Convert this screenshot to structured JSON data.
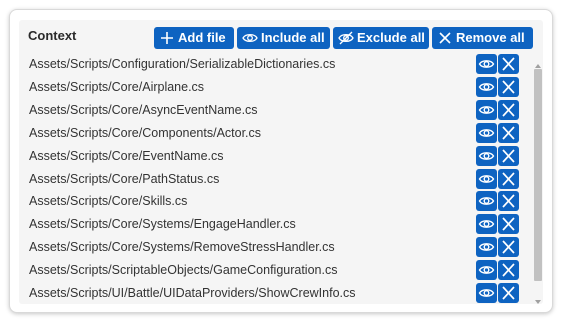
{
  "context_panel": {
    "title": "Context",
    "buttons": {
      "add_file": "Add file",
      "include_all": "Include all",
      "exclude_all": "Exclude all",
      "remove_all": "Remove all"
    },
    "files": [
      "Assets/Scripts/Configuration/SerializableDictionaries.cs",
      "Assets/Scripts/Core/Airplane.cs",
      "Assets/Scripts/Core/AsyncEventName.cs",
      "Assets/Scripts/Core/Components/Actor.cs",
      "Assets/Scripts/Core/EventName.cs",
      "Assets/Scripts/Core/PathStatus.cs",
      "Assets/Scripts/Core/Skills.cs",
      "Assets/Scripts/Core/Systems/EngageHandler.cs",
      "Assets/Scripts/Core/Systems/RemoveStressHandler.cs",
      "Assets/Scripts/ScriptableObjects/GameConfiguration.cs",
      "Assets/Scripts/UI/Battle/UIDataProviders/ShowCrewInfo.cs"
    ],
    "row_icons": [
      "eye-icon",
      "close-icon"
    ]
  },
  "colors": {
    "accent": "#0e63c1",
    "panel_background": "#f5f5f5",
    "text": "#333333"
  }
}
